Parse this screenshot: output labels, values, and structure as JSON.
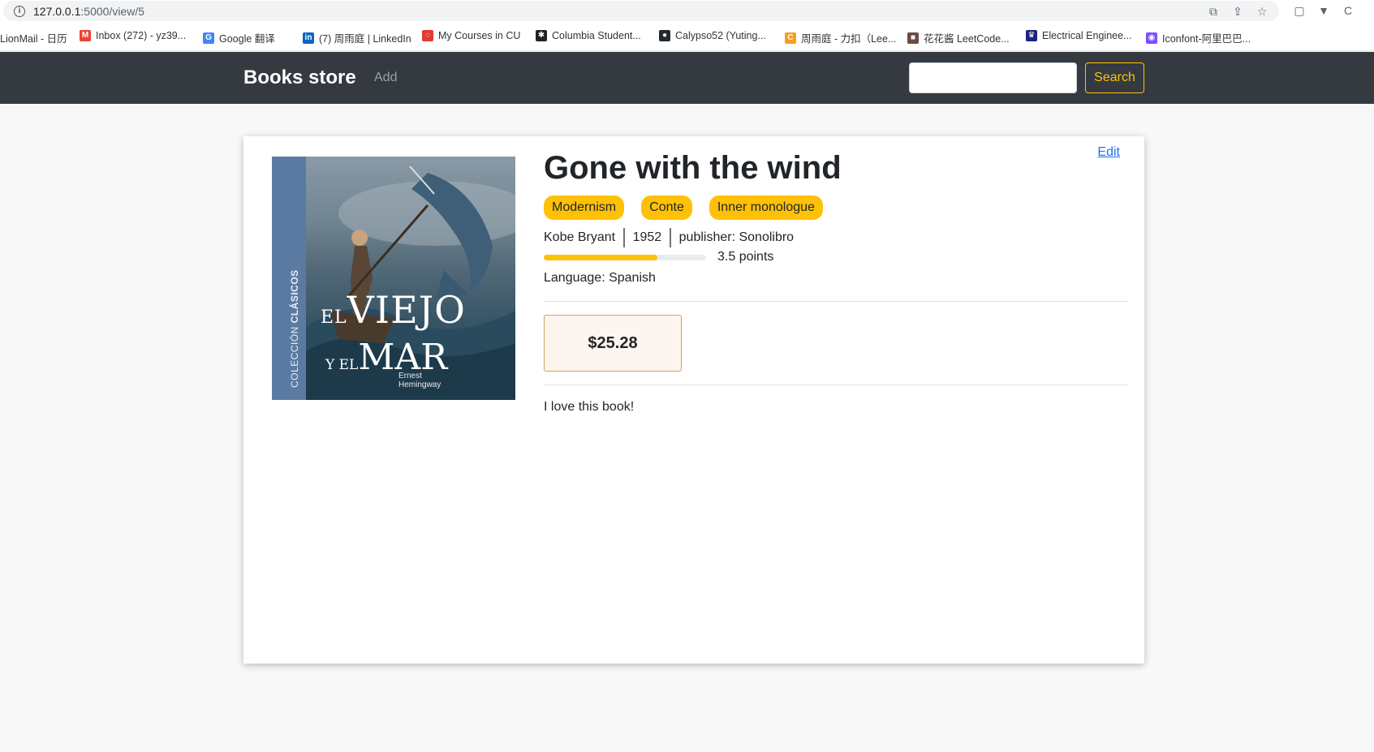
{
  "browser": {
    "url_host": "127.0.0.1",
    "url_rest": ":5000/view/5",
    "bookmarks": [
      {
        "label": "LionMail - 日历",
        "icon": "calendar-icon"
      },
      {
        "label": "Inbox (272) - yz39...",
        "icon": "gmail-icon"
      },
      {
        "label": "Google 翻译",
        "icon": "translate-icon"
      },
      {
        "label": "(7) 周雨庭 | LinkedIn",
        "icon": "linkedin-icon"
      },
      {
        "label": "My Courses in CU",
        "icon": "courses-icon"
      },
      {
        "label": "Columbia Student...",
        "icon": "columbia-icon"
      },
      {
        "label": "Calypso52 (Yuting...",
        "icon": "github-icon"
      },
      {
        "label": "周雨庭 - 力扣（Lee...",
        "icon": "leetcode-icon"
      },
      {
        "label": "花花酱 LeetCode...",
        "icon": "avatar-icon"
      },
      {
        "label": "Electrical Enginee...",
        "icon": "crown-icon"
      },
      {
        "label": "Iconfont-阿里巴巴...",
        "icon": "iconfont-icon"
      }
    ]
  },
  "navbar": {
    "brand": "Books store",
    "add_label": "Add",
    "search_placeholder": "",
    "search_label": "Search"
  },
  "book": {
    "edit_label": "Edit",
    "title": "Gone with the wind",
    "tags": [
      "Modernism",
      "Conte",
      "Inner monologue"
    ],
    "author": "Kobe Bryant",
    "year": "1952",
    "publisher": "publisher: Sonolibro",
    "rating_fraction": 0.7,
    "rating_text": "3.5 points",
    "language": "Language: Spanish",
    "price": "$25.28",
    "review": "I love this book!",
    "cover": {
      "spine_light": "COLECCIÓN ",
      "spine_bold": "CLÁSICOS",
      "line1_small": "EL",
      "line1_big": "VIEJO",
      "line2_small": "Y EL",
      "line2_big": "MAR",
      "author_first": "Ernest",
      "author_last": "Hemingway"
    }
  },
  "colors": {
    "navbar_bg": "#343a40",
    "accent": "#ffc107",
    "link": "#1a73e8"
  }
}
